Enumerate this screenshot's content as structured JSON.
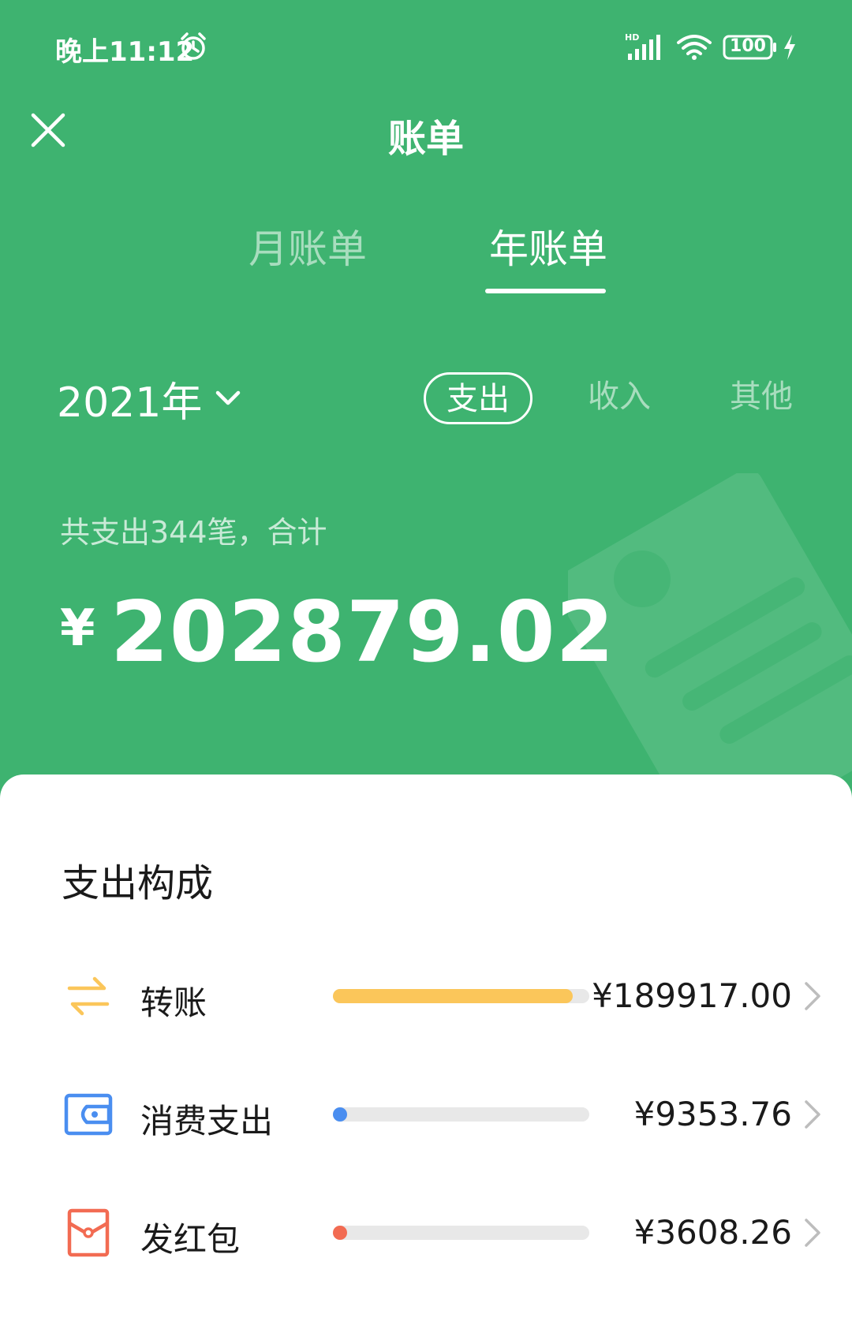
{
  "status_bar": {
    "time": "晚上11:12",
    "battery": "100",
    "icons": [
      "alarm-icon",
      "signal-icon",
      "wifi-icon",
      "battery-icon",
      "charge-icon"
    ]
  },
  "header": {
    "title": "账单",
    "close_icon": "close-icon"
  },
  "tabs": [
    {
      "label": "月账单",
      "active": false
    },
    {
      "label": "年账单",
      "active": true
    }
  ],
  "filter": {
    "year": "2021年",
    "options": [
      {
        "label": "支出",
        "active": true
      },
      {
        "label": "收入",
        "active": false
      },
      {
        "label": "其他",
        "active": false
      }
    ]
  },
  "summary": {
    "text": "共支出344笔，合计",
    "currency": "¥",
    "total": "202879.02"
  },
  "breakdown": {
    "title": "支出构成",
    "items": [
      {
        "label": "转账",
        "amount": "¥189917.00",
        "fraction": 0.936,
        "color": "#fbc65a",
        "icon": "transfer-icon"
      },
      {
        "label": "消费支出",
        "amount": "¥9353.76",
        "fraction": 0.046,
        "color": "#4a8ef0",
        "icon": "wallet-icon"
      },
      {
        "label": "发红包",
        "amount": "¥3608.26",
        "fraction": 0.018,
        "color": "#f26b52",
        "icon": "red-packet-icon"
      }
    ]
  },
  "colors": {
    "brand_green": "#3eb370",
    "transfer": "#fbc65a",
    "consumption": "#4a8ef0",
    "red_packet": "#f26b52"
  }
}
